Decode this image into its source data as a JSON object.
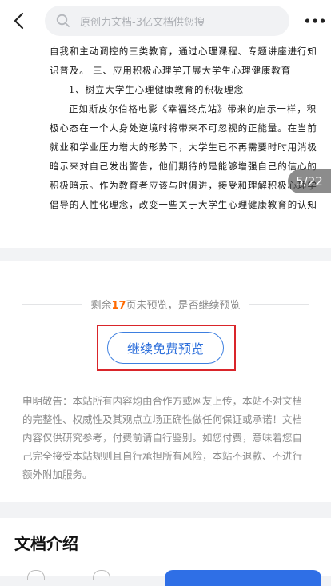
{
  "topbar": {
    "search_placeholder": "原创力文档-3亿文档供您搜",
    "icons": {
      "back": "chevron-left-icon",
      "search": "search-icon",
      "more": "more-dots-icon"
    }
  },
  "document": {
    "lines": [
      "自我和主动调控的三类教育，通过心理课程、专题讲座进行知",
      "识普及。    三、应用积极心理学开展大学生心理健康教育",
      "1、树立大学生心理健康教育的积极理念",
      "正如斯皮尔伯格电影《幸福终点站》带来的启示一样，积",
      "极心态在一个人身处逆境时将带来不可忽视的正能量。在当前",
      "就业和学业压力增大的形势下，大学生已不再需要时时用消极",
      "暗示来对自己发出警告，他们期待的是能够增强自己的信心的",
      "积极暗示。作为教育者应该与时俱进，接受和理解积极心理学",
      "倡导的人性化理念，改变一些关于大学生心理健康教育的认知"
    ],
    "page_indicator": "5/22"
  },
  "preview": {
    "remain_prefix": "剩余",
    "remain_count": "17",
    "remain_suffix": "页未预览，是否继续预览",
    "continue_label": "继续免费预览",
    "disclaimer": "申明敬告：本站所有内容均由合作方或网友上传，本站不对文档的完整性、权威性及其观点立场正确性做任何保证或承诺！文档内容仅供研究参考，付费前请自行鉴别。如您付费，意味着您自己完全接受本站规则且自行承担所有风险，本站不退款、不进行额外附加服务。"
  },
  "intro": {
    "title": "文档介绍"
  },
  "colors": {
    "accent": "#2d6fdb",
    "highlight_number": "#ff6a00",
    "frame": "#d9252a"
  }
}
